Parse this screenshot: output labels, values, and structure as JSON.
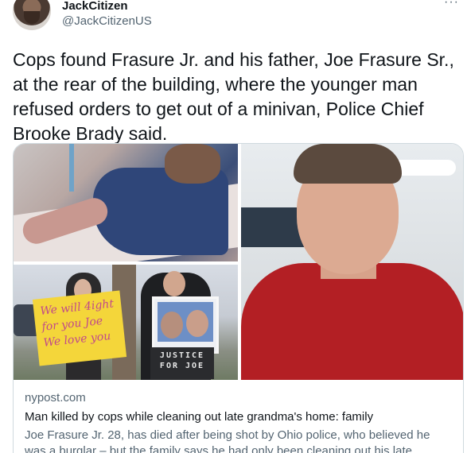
{
  "author": {
    "display_name": "JackCitizen",
    "handle": "@JackCitizenUS"
  },
  "tweet": {
    "text": "Cops found Frasure Jr. and his father, Joe Frasure Sr., at the rear of the building, where the younger man refused orders to get out of a minivan, Police Chief Brooke Brady said."
  },
  "card": {
    "domain": "nypost.com",
    "headline": "Man killed by cops while cleaning out late grandma's home: family",
    "description": "Joe Frasure Jr. 28, has died after being shot by Ohio police, who believed he was a burglar – but the family says he had only been cleaning out his late ...",
    "signs": {
      "yellow_sign": "We will 4ight for you Joe We love you",
      "justice_sign": "JUSTICE FOR JOE"
    }
  },
  "icons": {
    "more": "more-options-icon"
  },
  "colors": {
    "text_primary": "#0f1419",
    "text_secondary": "#536471",
    "border": "#cfd9de"
  }
}
